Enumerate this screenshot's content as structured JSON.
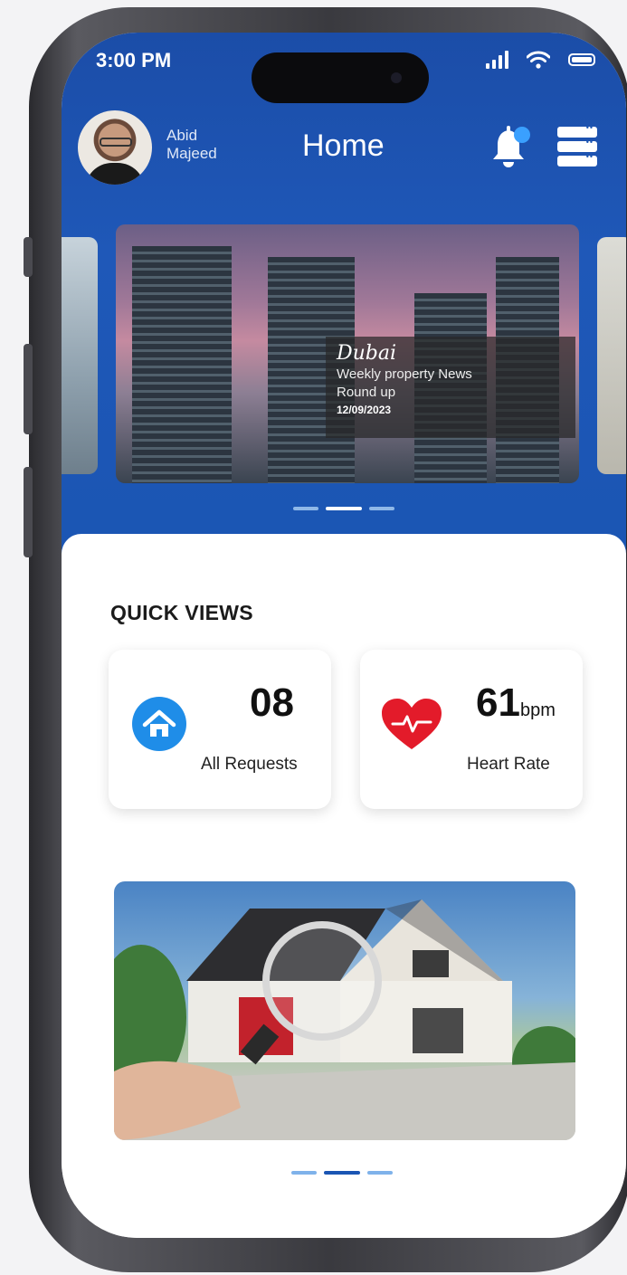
{
  "status_bar": {
    "time": "3:00 PM",
    "icons": [
      "cellular-signal-icon",
      "wifi-icon",
      "battery-icon"
    ]
  },
  "header": {
    "user_first_name": "Abid",
    "user_last_name": "Majeed",
    "title": "Home",
    "icons": [
      "notification-bell-icon",
      "menu-icon"
    ]
  },
  "news_carousel": {
    "city": "Dubai",
    "headline_line1": "Weekly property News",
    "headline_line2": "Round up",
    "date": "12/09/2023",
    "page_count": 3,
    "active_page": 2
  },
  "quick_views": {
    "title": "QUICK VIEWS",
    "cards": [
      {
        "value": "08",
        "unit": "",
        "label": "All Requests",
        "icon": "home-icon",
        "icon_color": "#1f8de8"
      },
      {
        "value": "61",
        "unit": "bpm",
        "label": "Heart Rate",
        "icon": "heart-pulse-icon",
        "icon_color": "#e31b2a"
      }
    ]
  },
  "promo_carousel": {
    "image": "house-search-photo",
    "page_count": 3,
    "active_page": 2
  },
  "colors": {
    "primary_blue": "#1a55b3",
    "dot_inactive": "#7fb2ea",
    "dot_active_light": "#ffffff"
  }
}
